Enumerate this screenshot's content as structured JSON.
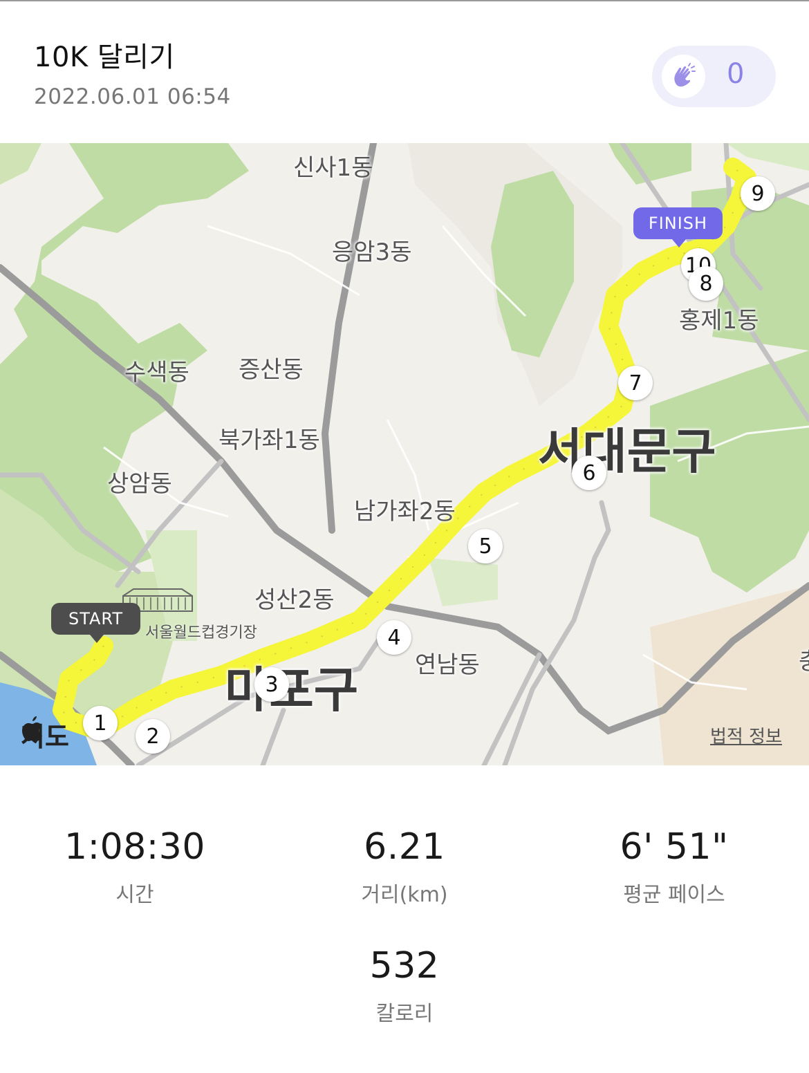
{
  "activity": {
    "title": "10K 달리기",
    "datetime": "2022.06.01 06:54",
    "clap_count": "0",
    "clap_icon": "clap-hands-icon",
    "accent_color": "#8b82e6"
  },
  "map": {
    "labels": {
      "sinsa": "신사1동",
      "eungam": "응암3동",
      "susaek": "수색동",
      "jeungsan": "증산동",
      "bukgajwa": "북가좌1동",
      "sangam": "상암동",
      "namgajwa": "남가좌2동",
      "seongsan": "성산2동",
      "yeonnam": "연남동",
      "hongje": "홍제1동",
      "seodaemun": "서대문구",
      "mapo": "마포구",
      "stadium": "서울월드컵경기장",
      "edge": "충"
    },
    "markers": [
      "1",
      "2",
      "3",
      "4",
      "5",
      "6",
      "7",
      "8",
      "9",
      "10"
    ],
    "start_label": "START",
    "finish_label": "FINISH",
    "provider": "지도",
    "legal": "법적 정보",
    "route_color": "#f5f53a"
  },
  "stats": {
    "time": {
      "value": "1:08:30",
      "label": "시간"
    },
    "distance": {
      "value": "6.21",
      "label": "거리(km)"
    },
    "pace": {
      "value": "6' 51\"",
      "label": "평균 페이스"
    },
    "calories": {
      "value": "532",
      "label": "칼로리"
    }
  }
}
